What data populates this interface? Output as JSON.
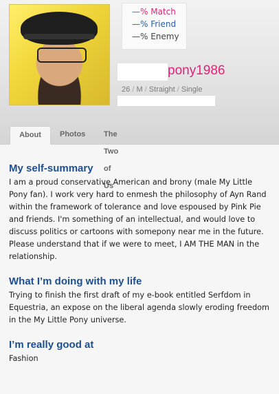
{
  "profile": {
    "match_lines": [
      {
        "prefix": "—",
        "text": "% Match",
        "color": "#e0237a"
      },
      {
        "prefix": "—",
        "text": "% Friend",
        "color": "#2b5fa8"
      },
      {
        "prefix": "—",
        "text": "% Enemy",
        "color": "#444444"
      }
    ],
    "username": "pony1986",
    "details": {
      "age": "26",
      "gender": "M",
      "orientation": "Straight",
      "status": "Single",
      "separator": "/"
    },
    "photo_icon": "user-photo"
  },
  "tabs": [
    {
      "label": "About",
      "active": true
    },
    {
      "label": "Photos",
      "active": false
    },
    {
      "label": "The Two of Us",
      "active": false
    }
  ],
  "sections": [
    {
      "title": "My self-summary",
      "body": "I am a proud conservative American and brony (male My Little Pony fan). I work very hard to enmesh the philosophy of Ayn Rand within the framework of tolerance and love espoused by Pink Pie and friends. I'm something of an intellectual, and would love to discuss politics or cartoons with somepony near me in the future. Please understand that if we were to meet, I AM THE MAN in the relationship."
    },
    {
      "title": "What I’m doing with my life",
      "body": "Trying to finish the first draft of my e-book entitled Serfdom in Equestria, an expose on the liberal agenda slowly eroding freedom in the My Little Pony universe."
    },
    {
      "title": "I’m really good at",
      "body": "Fashion"
    }
  ],
  "colors": {
    "accent_pink": "#e0237a",
    "heading_blue": "#1d4f8f"
  }
}
